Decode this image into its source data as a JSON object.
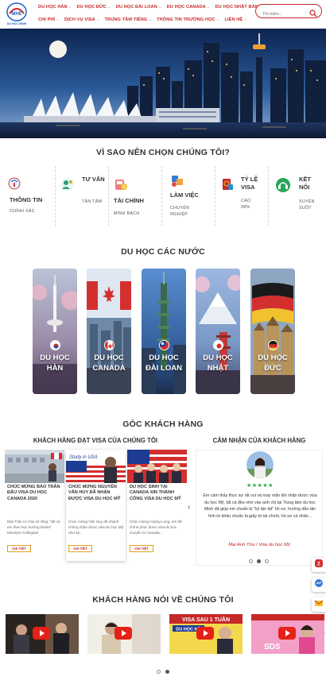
{
  "colors": {
    "brand": "#c62828",
    "accent_gold": "#e0a020",
    "green": "#27a744",
    "text": "#333333"
  },
  "header": {
    "nav_row1": [
      {
        "label": "DU HỌC HÀN"
      },
      {
        "label": "DU HỌC ĐỨC"
      },
      {
        "label": "DU HỌC ĐÀI LOAN"
      },
      {
        "label": "DU HỌC CANADA"
      },
      {
        "label": "DU HỌC NHẬT BẢN"
      }
    ],
    "nav_row2": [
      {
        "label": "CHI PHÍ"
      },
      {
        "label": "DỊCH VỤ VISA"
      },
      {
        "label": "TRUNG TÂM TIẾNG"
      },
      {
        "label": "THÔNG TIN TRƯỜNG HỌC"
      },
      {
        "label": "LIÊN HỆ"
      }
    ],
    "search_placeholder": "Tìm kiếm...",
    "logo_text": "DU HỌC MINH"
  },
  "why": {
    "title": "VÌ SAO NÊN CHỌN CHÚNG TÔI?",
    "items": [
      {
        "title": "THÔNG TIN",
        "sub": "CHÍNH XÁC",
        "icon": "info-icon"
      },
      {
        "title": "TƯ VẤN",
        "sub": "TẬN TÂM",
        "icon": "consult-icon"
      },
      {
        "title": "TÀI CHÍNH",
        "sub": "MINH BẠCH",
        "icon": "finance-icon"
      },
      {
        "title": "LÀM VIỆC",
        "sub": "CHUYÊN NGHIỆP",
        "icon": "work-icon"
      },
      {
        "title": "TỶ LỆ VISA",
        "sub": "CAO 98%",
        "icon": "passport-icon"
      },
      {
        "title": "KẾT NỐI",
        "sub": "XUYÊN SUỐT",
        "icon": "headset-icon"
      }
    ]
  },
  "countries": {
    "title": "DU HỌC CÁC NƯỚC",
    "items": [
      {
        "label": "DU HỌC HÀN",
        "flag": "korea"
      },
      {
        "label": "DU HỌC CANADA",
        "flag": "canada"
      },
      {
        "label": "DU HỌC ĐÀI LOAN",
        "flag": "taiwan"
      },
      {
        "label": "DU HỌC NHẬT",
        "flag": "japan"
      },
      {
        "label": "DU HỌC ĐỨC",
        "flag": "germany"
      }
    ]
  },
  "corner": {
    "title": "GÓC KHÁCH HÀNG",
    "visa_heading": "KHÁCH HÀNG ĐẠT VISA CỦA CHÚNG TÔI",
    "review_heading": "CẢM NHẬN CỦA KHÁCH HÀNG",
    "visa_cards": [
      {
        "title": "CHÚC MỪNG BẢO TRÂN ĐẬU VISA DU HỌC CANADA 2020",
        "desc": "Bảo Trân có chia sẻ rằng: \"tất cả em theo học trường Daniel McIntyre Collegiate",
        "button": "CHI TIẾT"
      },
      {
        "title": "CHÚC MỪNG NGUYỄN VĂN HUY ĐÃ NHẬN ĐƯỢC VISA DU HỌC MỸ",
        "desc": "Chúc mừng Văn Huy đã nhanh chóng nhận được visa Du học Mỹ như kỳ...",
        "button": "CHI TIẾT",
        "badge": "Study in USA"
      },
      {
        "title": "DU HỌC SINH TẠI CANADA XIN THÀNH CÔNG VISA DU HỌC MỸ",
        "desc": "Chúc mừng Hoàng Long, em đã chính phục được visa du học chuyển từ Canada...",
        "button": "CHI TIẾT"
      }
    ],
    "review": {
      "stars": "★★★★★",
      "text": "Em cảm thấy thực sự rất vui và may mắn khi nhận được visa du học Mỹ, tất cả đều nhờ vào anh chị tại Trung tâm du học Minh đã giúp em chuẩn bị \"kỹ tận tật\" hồ sơ, hướng dẫn tận tình từ khâu chuẩn bị giấy tờ tài chính, hồ sơ cá nhân...",
      "author": "Mai Anh Thư / Visa du học Mỹ"
    }
  },
  "videos": {
    "title": "KHÁCH HÀNG NÓI VỀ CHÚNG TÔI",
    "items": [
      {
        "caption": ""
      },
      {
        "caption": ""
      },
      {
        "caption": "VISA SAU 1 TUẦN",
        "sub": "DU HỌC MỸ"
      },
      {
        "caption": "SDS"
      }
    ]
  },
  "floating": [
    "zalo-icon",
    "messenger-icon",
    "mail-icon",
    "phone-icon"
  ]
}
